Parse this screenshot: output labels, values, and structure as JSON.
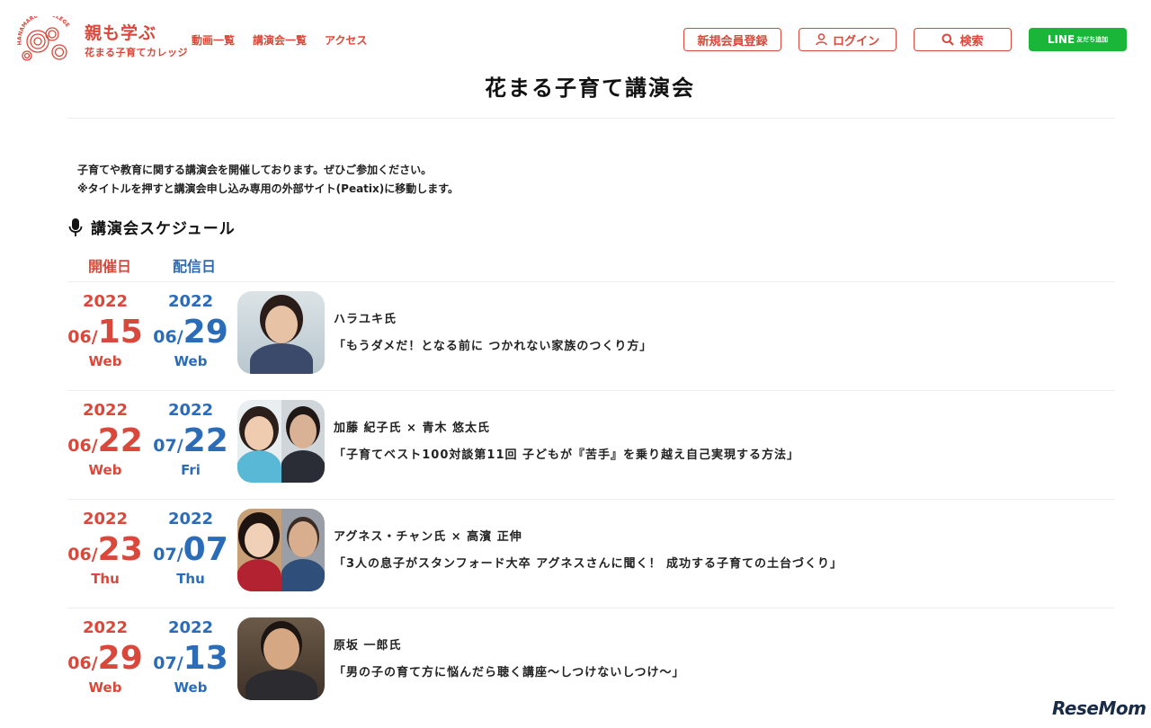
{
  "header": {
    "logo_title": "親も学ぶ",
    "logo_sub": "花まる子育てカレッジ",
    "logo_ring_text": "HANAMARU・COLLEGE",
    "nav": [
      "動画一覧",
      "講演会一覧",
      "アクセス"
    ],
    "register_label": "新規会員登録",
    "login_label": "ログイン",
    "search_label": "検索",
    "line_label": "LINE",
    "line_sub": "友だち追加"
  },
  "page_title": "花まる子育て講演会",
  "intro": {
    "line1": "子育てや教育に関する講演会を開催しております。ぜひご参加ください。",
    "line2": "※タイトルを押すと講演会申し込み専用の外部サイト(Peatix)に移動します。"
  },
  "schedule": {
    "heading": "講演会スケジュール",
    "col_open": "開催日",
    "col_stream": "配信日",
    "events": [
      {
        "open": {
          "year": "2022",
          "month": "06/",
          "day": "15",
          "weekday": "Web"
        },
        "stream": {
          "year": "2022",
          "month": "06/",
          "day": "29",
          "weekday": "Web"
        },
        "speaker": "ハラユキ氏",
        "title": "「もうダメだ！となる前に つかれない家族のつくり方」"
      },
      {
        "open": {
          "year": "2022",
          "month": "06/",
          "day": "22",
          "weekday": "Web"
        },
        "stream": {
          "year": "2022",
          "month": "07/",
          "day": "22",
          "weekday": "Fri"
        },
        "speaker": "加藤 紀子氏 × 青木 悠太氏",
        "title": "「子育てベスト100対談第11回 子どもが『苦手』を乗り越え自己実現する方法」"
      },
      {
        "open": {
          "year": "2022",
          "month": "06/",
          "day": "23",
          "weekday": "Thu"
        },
        "stream": {
          "year": "2022",
          "month": "07/",
          "day": "07",
          "weekday": "Thu"
        },
        "speaker": "アグネス・チャン氏 × 高濱 正伸",
        "title": "「3人の息子がスタンフォード大卒 アグネスさんに聞く！ 成功する子育ての土台づくり」"
      },
      {
        "open": {
          "year": "2022",
          "month": "06/",
          "day": "29",
          "weekday": "Web"
        },
        "stream": {
          "year": "2022",
          "month": "07/",
          "day": "13",
          "weekday": "Web"
        },
        "speaker": "原坂 一郎氏",
        "title": "「男の子の育て方に悩んだら聴く講座〜しつけないしつけ〜」"
      }
    ]
  },
  "watermark": "ReseMom",
  "colors": {
    "accent": "#d9483b",
    "stream": "#2b6cb8",
    "line": "#19b63a"
  }
}
